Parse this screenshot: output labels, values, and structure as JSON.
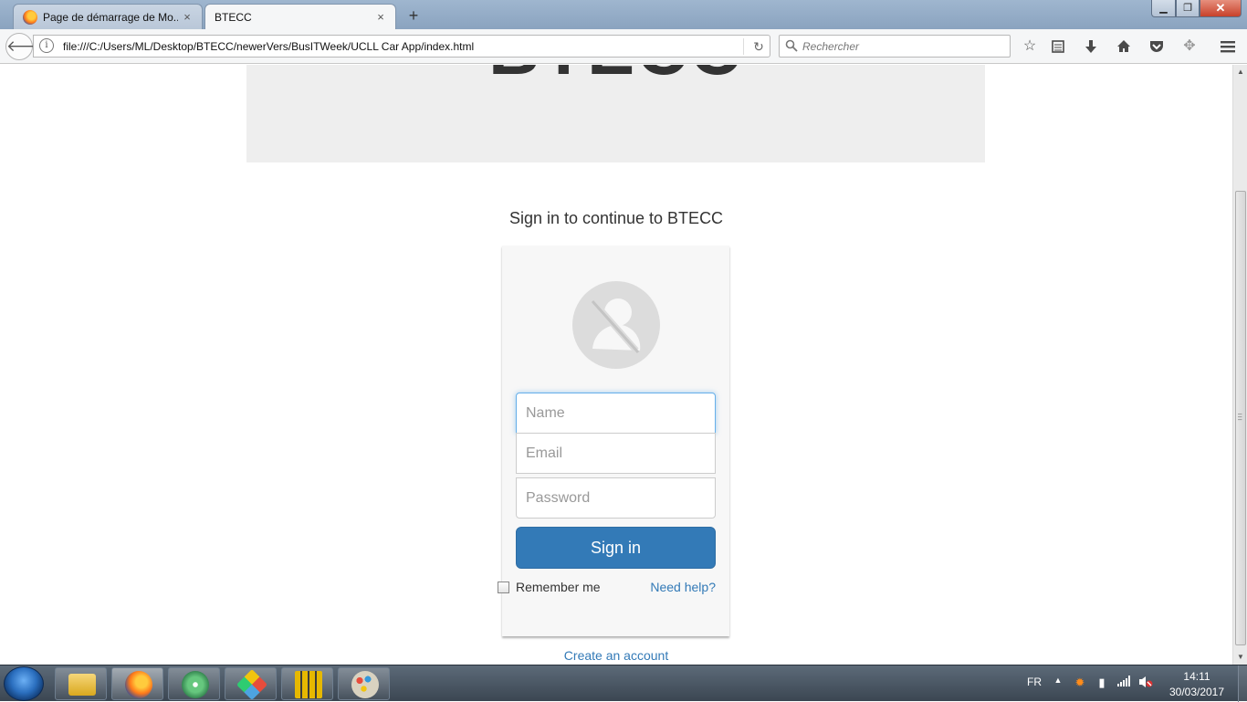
{
  "browser": {
    "tabs": [
      {
        "label": "Page de démarrage de Mo..."
      },
      {
        "label": "BTECC"
      }
    ],
    "new_tab_label": "+",
    "url": "file:///C:/Users/ML/Desktop/BTECC/newerVers/BusITWeek/UCLL Car App/index.html",
    "search_placeholder": "Rechercher",
    "close_glyph": "×",
    "window_controls": {
      "minimize": "▁",
      "maximize": "❐",
      "close": "✕"
    }
  },
  "page": {
    "jumbotron_title": "BTECC",
    "signin_heading": "Sign in to continue to BTECC",
    "form": {
      "name_placeholder": "Name",
      "email_placeholder": "Email",
      "password_placeholder": "Password",
      "signin_label": "Sign in",
      "remember_label": "Remember me",
      "help_link": "Need help?"
    },
    "create_account": "Create an account"
  },
  "taskbar": {
    "apps": [
      {
        "icon": "file-explorer-icon",
        "color": "#f2c94c"
      },
      {
        "icon": "firefox-icon",
        "color": "#ff7a1a",
        "active": true
      },
      {
        "icon": "atom-icon",
        "color": "#66c77e"
      },
      {
        "icon": "git-icon",
        "color": "#4da3e0"
      },
      {
        "icon": "archive-icon",
        "color": "#e6b800"
      },
      {
        "icon": "paint-icon",
        "color": "#d9d2c0"
      }
    ],
    "language": "FR",
    "clock_time": "14:11",
    "clock_date": "30/03/2017"
  },
  "colors": {
    "primary": "#337ab7",
    "jumbotron_bg": "#eeeeee",
    "card_bg": "#f7f7f7"
  }
}
